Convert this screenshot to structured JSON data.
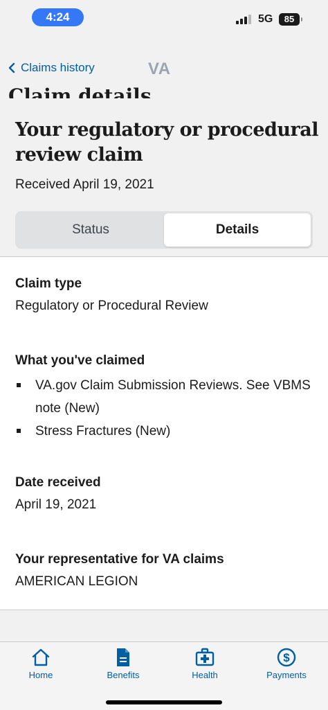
{
  "status_bar": {
    "time": "4:24",
    "network": "5G",
    "battery": "85"
  },
  "nav": {
    "back_label": "Claims history",
    "logo": "VA"
  },
  "page": {
    "cutoff_heading": "Claim details",
    "title": "Your regulatory or procedural review claim",
    "received": "Received April 19, 2021"
  },
  "segmented": {
    "status_label": "Status",
    "details_label": "Details",
    "selected": "Details"
  },
  "details": {
    "claim_type": {
      "label": "Claim type",
      "value": "Regulatory or Procedural Review"
    },
    "claimed": {
      "label": "What you've claimed",
      "items": [
        "VA.gov Claim Submission Reviews. See VBMS note (New)",
        "Stress Fractures (New)"
      ]
    },
    "date_received": {
      "label": "Date received",
      "value": "April 19, 2021"
    },
    "representative": {
      "label": "Your representative for VA claims",
      "value": "AMERICAN LEGION"
    }
  },
  "tabbar": {
    "tabs": [
      {
        "label": "Home",
        "icon": "home-icon"
      },
      {
        "label": "Benefits",
        "icon": "document-icon"
      },
      {
        "label": "Health",
        "icon": "medical-kit-icon"
      },
      {
        "label": "Payments",
        "icon": "dollar-circle-icon"
      }
    ]
  },
  "colors": {
    "link": "#005ea2",
    "background": "#f1f1f1",
    "time_pill": "#3478f6"
  }
}
